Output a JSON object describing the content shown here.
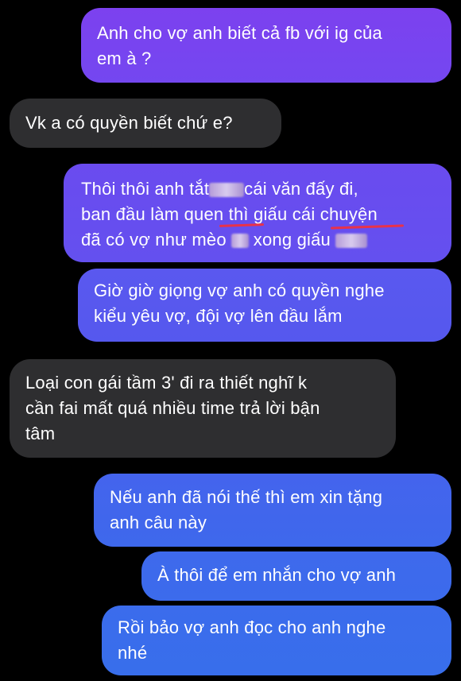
{
  "colors": {
    "background": "#000000",
    "received_bubble": "#2e2e30",
    "sent_gradient_top": "#7a43ef",
    "sent_gradient_mid": "#5c55f0",
    "sent_gradient_bottom": "#3b6cec",
    "underline": "#e8324a"
  },
  "messages": [
    {
      "direction": "sent",
      "lines": [
        "Anh cho vợ anh biết cả fb với ig của",
        "em à ?"
      ]
    },
    {
      "direction": "received",
      "lines": [
        "Vk a có quyền biết chứ e?"
      ]
    },
    {
      "direction": "sent",
      "lines": [
        "Thôi thôi anh tắt",
        "cái văn đấy đi,",
        "ban đầu làm quen thì giấu cái chuyện",
        "đã có vợ như mèo",
        "xong giấu"
      ]
    },
    {
      "direction": "sent",
      "lines": [
        "Giờ giờ giọng vợ anh có quyền nghe",
        "kiểu yêu vợ, đội vợ lên đầu lắm"
      ]
    },
    {
      "direction": "received",
      "lines": [
        "Loại con gái tầm 3' đi ra thiết nghĩ k",
        "cần fai mất quá nhiều time trả lời bận",
        "tâm"
      ]
    },
    {
      "direction": "sent",
      "lines": [
        "Nếu anh đã nói thế thì em xin tặng",
        "anh câu này"
      ]
    },
    {
      "direction": "sent",
      "lines": [
        "À thôi để em nhắn cho vợ anh"
      ]
    },
    {
      "direction": "sent",
      "lines": [
        "Rồi bảo vợ anh đọc cho anh nghe",
        "nhé"
      ]
    }
  ]
}
